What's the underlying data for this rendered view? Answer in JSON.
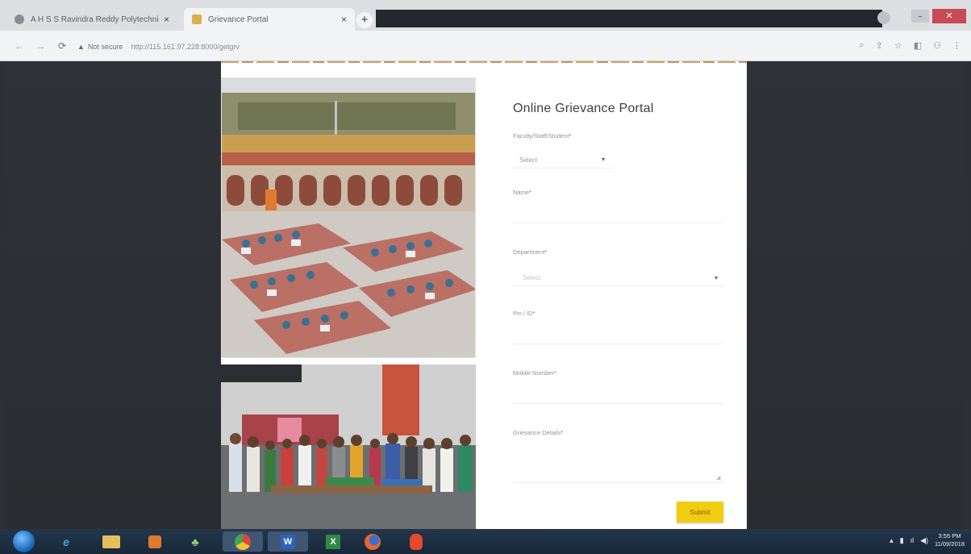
{
  "browser": {
    "tabs": [
      {
        "title": "A H S S Ravindra Reddy Polytechnic",
        "close": "×"
      },
      {
        "title": "Grievance Portal",
        "close": "×"
      }
    ],
    "new_tab": "+",
    "window_controls": {
      "minimize": "–",
      "close": "✕"
    },
    "security": "Not secure",
    "url": "http://115.161.97.228:8000/getgrv"
  },
  "page": {
    "colors": {
      "accent_yellow": "#f2cc10",
      "required_star": "#e54b4b",
      "title_text": "#3c3f44"
    },
    "form": {
      "title": "Online Grievance Portal",
      "fields": [
        {
          "label": "Faculty/Staff/Student",
          "required": "*",
          "value": "Select",
          "kind": "select"
        },
        {
          "label": "Name",
          "required": "*",
          "value": "",
          "kind": "text"
        },
        {
          "label": "Department",
          "required": "*",
          "value": "Select",
          "kind": "select"
        },
        {
          "label": "Pin / ID",
          "required": "*",
          "value": "",
          "kind": "text"
        },
        {
          "label": "Mobile Number",
          "required": "*",
          "value": "",
          "kind": "text"
        },
        {
          "label": "Grievance Details",
          "required": "*",
          "value": "",
          "kind": "textarea"
        }
      ],
      "caret": "▾",
      "submit_label": "Submit"
    }
  },
  "taskbar": {
    "items": [
      "internet-explorer-icon",
      "file-explorer-icon",
      "media-player-icon",
      "mesh-icon",
      "chrome-icon",
      "word-icon",
      "excel-icon",
      "firefox-icon",
      "media-icon"
    ],
    "clock_time": "3:55 PM",
    "clock_date": "11/09/2018"
  }
}
